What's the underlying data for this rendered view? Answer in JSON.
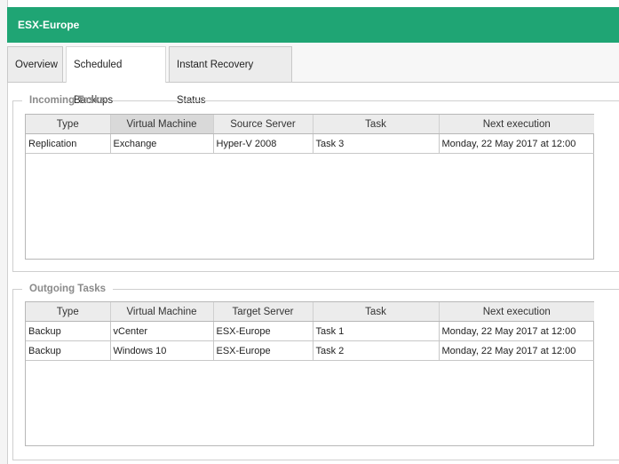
{
  "window": {
    "title": "ESX-Europe"
  },
  "tabs": [
    {
      "label": "Overview"
    },
    {
      "label": "Scheduled Backups"
    },
    {
      "label": "Instant Recovery Status"
    }
  ],
  "incoming": {
    "legend": "Incoming Tasks",
    "columns": [
      "Type",
      "Virtual Machine",
      "Source Server",
      "Task",
      "Next execution"
    ],
    "rows": [
      [
        "Replication",
        "Exchange",
        "Hyper-V 2008",
        "Task 3",
        "Monday, 22 May 2017 at 12:00"
      ]
    ]
  },
  "outgoing": {
    "legend": "Outgoing Tasks",
    "columns": [
      "Type",
      "Virtual Machine",
      "Target Server",
      "Task",
      "Next execution"
    ],
    "rows": [
      [
        "Backup",
        "vCenter",
        "ESX-Europe",
        "Task 1",
        "Monday, 22 May 2017 at 12:00"
      ],
      [
        "Backup",
        "Windows 10",
        "ESX-Europe",
        "Task 2",
        "Monday, 22 May 2017 at 12:00"
      ]
    ]
  },
  "colors": {
    "titlebar": "#1fa574"
  }
}
